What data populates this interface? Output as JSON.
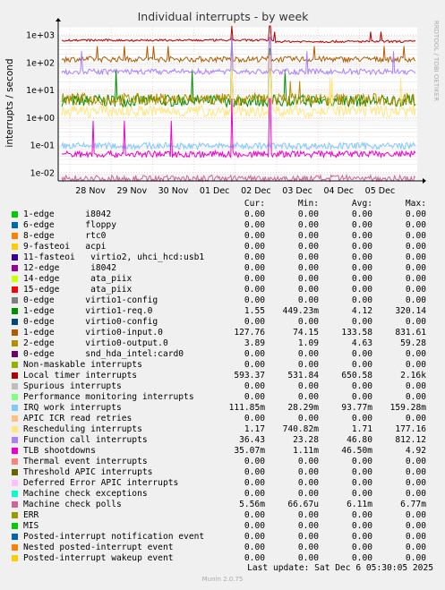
{
  "chart_data": {
    "type": "line",
    "title": "Individual interrupts - by week",
    "ylabel": "interrupts / second",
    "side_label": "RRDTOOL / TOBI OETIKER",
    "y_scale": "log",
    "ylim": [
      0.005,
      2000
    ],
    "y_ticks": [
      "1e-02",
      "1e-01",
      "1e+00",
      "1e+01",
      "1e+02",
      "1e+03"
    ],
    "x_ticks": [
      "28 Nov",
      "29 Nov",
      "30 Nov",
      "01 Dec",
      "02 Dec",
      "03 Dec",
      "04 Dec",
      "05 Dec"
    ],
    "grid": true,
    "legend_position": "bottom",
    "series": [
      {
        "name": "1-edge i8042",
        "color": "#00cc00",
        "cur": "0.00",
        "min": "0.00",
        "avg": "0.00",
        "max": "0.00"
      },
      {
        "name": "6-edge floppy",
        "color": "#0066b3",
        "cur": "0.00",
        "min": "0.00",
        "avg": "0.00",
        "max": "0.00"
      },
      {
        "name": "8-edge rtc0",
        "color": "#ff8000",
        "cur": "0.00",
        "min": "0.00",
        "avg": "0.00",
        "max": "0.00"
      },
      {
        "name": "9-fasteoi acpi",
        "color": "#ffcc00",
        "cur": "0.00",
        "min": "0.00",
        "avg": "0.00",
        "max": "0.00"
      },
      {
        "name": "11-fasteoi virtio2, uhci_hcd:usb1",
        "color": "#330099",
        "cur": "0.00",
        "min": "0.00",
        "avg": "0.00",
        "max": "0.00"
      },
      {
        "name": "12-edge i8042",
        "color": "#990099",
        "cur": "0.00",
        "min": "0.00",
        "avg": "0.00",
        "max": "0.00"
      },
      {
        "name": "14-edge ata_piix",
        "color": "#ccff00",
        "cur": "0.00",
        "min": "0.00",
        "avg": "0.00",
        "max": "0.00"
      },
      {
        "name": "15-edge ata_piix",
        "color": "#ff0000",
        "cur": "0.00",
        "min": "0.00",
        "avg": "0.00",
        "max": "0.00"
      },
      {
        "name": "0-edge virtio1-config",
        "color": "#808080",
        "cur": "0.00",
        "min": "0.00",
        "avg": "0.00",
        "max": "0.00"
      },
      {
        "name": "1-edge virtio1-req.0",
        "color": "#008f00",
        "cur": "1.55",
        "min": "449.23m",
        "avg": "4.12",
        "max": "320.14"
      },
      {
        "name": "0-edge virtio0-config",
        "color": "#00487d",
        "cur": "0.00",
        "min": "0.00",
        "avg": "0.00",
        "max": "0.00"
      },
      {
        "name": "1-edge virtio0-input.0",
        "color": "#b35a00",
        "cur": "127.76",
        "min": "74.15",
        "avg": "133.58",
        "max": "831.61"
      },
      {
        "name": "2-edge virtio0-output.0",
        "color": "#b38f00",
        "cur": "3.89",
        "min": "1.09",
        "avg": "4.63",
        "max": "59.28"
      },
      {
        "name": "0-edge snd_hda_intel:card0",
        "color": "#6b006b",
        "cur": "0.00",
        "min": "0.00",
        "avg": "0.00",
        "max": "0.00"
      },
      {
        "name": "Non-maskable interrupts",
        "color": "#8fb300",
        "cur": "0.00",
        "min": "0.00",
        "avg": "0.00",
        "max": "0.00"
      },
      {
        "name": "Local timer interrupts",
        "color": "#b30000",
        "cur": "593.37",
        "min": "531.84",
        "avg": "650.58",
        "max": "2.16k"
      },
      {
        "name": "Spurious interrupts",
        "color": "#bebebe",
        "cur": "0.00",
        "min": "0.00",
        "avg": "0.00",
        "max": "0.00"
      },
      {
        "name": "Performance monitoring interrupts",
        "color": "#80ff80",
        "cur": "0.00",
        "min": "0.00",
        "avg": "0.00",
        "max": "0.00"
      },
      {
        "name": "IRQ work interrupts",
        "color": "#80c9ff",
        "cur": "111.85m",
        "min": "28.29m",
        "avg": "93.77m",
        "max": "159.28m"
      },
      {
        "name": "APIC ICR read retries",
        "color": "#ffc080",
        "cur": "0.00",
        "min": "0.00",
        "avg": "0.00",
        "max": "0.00"
      },
      {
        "name": "Rescheduling interrupts",
        "color": "#ffe680",
        "cur": "1.17",
        "min": "740.82m",
        "avg": "1.71",
        "max": "177.16"
      },
      {
        "name": "Function call interrupts",
        "color": "#aa80ff",
        "cur": "36.43",
        "min": "23.28",
        "avg": "46.80",
        "max": "812.12"
      },
      {
        "name": "TLB shootdowns",
        "color": "#ee00cc",
        "cur": "35.07m",
        "min": "1.11m",
        "avg": "46.50m",
        "max": "4.92"
      },
      {
        "name": "Thermal event interrupts",
        "color": "#ff8080",
        "cur": "0.00",
        "min": "0.00",
        "avg": "0.00",
        "max": "0.00"
      },
      {
        "name": "Threshold APIC interrupts",
        "color": "#666600",
        "cur": "0.00",
        "min": "0.00",
        "avg": "0.00",
        "max": "0.00"
      },
      {
        "name": "Deferred Error APIC interrupts",
        "color": "#ffbfff",
        "cur": "0.00",
        "min": "0.00",
        "avg": "0.00",
        "max": "0.00"
      },
      {
        "name": "Machine check exceptions",
        "color": "#00ffcc",
        "cur": "0.00",
        "min": "0.00",
        "avg": "0.00",
        "max": "0.00"
      },
      {
        "name": "Machine check polls",
        "color": "#cc6699",
        "cur": "5.56m",
        "min": "66.67u",
        "avg": "6.11m",
        "max": "6.77m"
      },
      {
        "name": "ERR",
        "color": "#999900",
        "cur": "0.00",
        "min": "0.00",
        "avg": "0.00",
        "max": "0.00"
      },
      {
        "name": "MIS",
        "color": "#00cc00",
        "cur": "0.00",
        "min": "0.00",
        "avg": "0.00",
        "max": "0.00"
      },
      {
        "name": "Posted-interrupt notification event",
        "color": "#0066b3",
        "cur": "0.00",
        "min": "0.00",
        "avg": "0.00",
        "max": "0.00"
      },
      {
        "name": "Nested posted-interrupt event",
        "color": "#ff8000",
        "cur": "0.00",
        "min": "0.00",
        "avg": "0.00",
        "max": "0.00"
      },
      {
        "name": "Posted-interrupt wakeup event",
        "color": "#ffcc00",
        "cur": "0.00",
        "min": "0.00",
        "avg": "0.00",
        "max": "0.00"
      }
    ]
  },
  "legend": {
    "labels": [
      "1-edge      i8042",
      "6-edge      floppy",
      "8-edge      rtc0",
      "9-fasteoi   acpi",
      "11-fasteoi   virtio2, uhci_hcd:usb1",
      "12-edge      i8042",
      "14-edge      ata_piix",
      "15-edge      ata_piix",
      "0-edge      virtio1-config",
      "1-edge      virtio1-req.0",
      "0-edge      virtio0-config",
      "1-edge      virtio0-input.0",
      "2-edge      virtio0-output.0",
      "0-edge      snd_hda_intel:card0",
      "Non-maskable interrupts",
      "Local timer interrupts",
      "Spurious interrupts",
      "Performance monitoring interrupts",
      "IRQ work interrupts",
      "APIC ICR read retries",
      "Rescheduling interrupts",
      "Function call interrupts",
      "TLB shootdowns",
      "Thermal event interrupts",
      "Threshold APIC interrupts",
      "Deferred Error APIC interrupts",
      "Machine check exceptions",
      "Machine check polls",
      "ERR",
      "MIS",
      "Posted-interrupt notification event",
      "Nested posted-interrupt event",
      "Posted-interrupt wakeup event"
    ],
    "headers": {
      "cur": "Cur:",
      "min": "Min:",
      "avg": "Avg:",
      "max": "Max:"
    }
  },
  "footer": {
    "last_update": "Last update: Sat Dec  6 05:30:05 2025",
    "version": "Munin 2.0.75"
  }
}
